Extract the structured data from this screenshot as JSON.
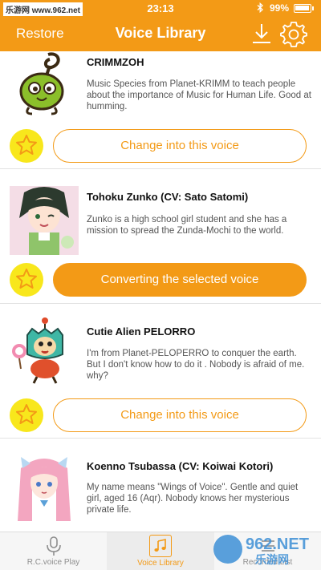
{
  "status_bar": {
    "watermark": "乐游网 www.962.net",
    "time": "23:13",
    "bluetooth_icon": "bluetooth-icon",
    "battery": "99%"
  },
  "nav": {
    "restore_label": "Restore",
    "title": "Voice Library",
    "download_icon": "download-icon",
    "settings_icon": "gear-icon"
  },
  "voices": [
    {
      "name": "CRIMMZOH",
      "description": "Music Species from Planet-KRIMM to teach people about the importance of Music for Human Life. Good at humming.",
      "button_label": "Change into this voice",
      "selected": false
    },
    {
      "name": "Tohoku Zunko (CV: Sato Satomi)",
      "description": "Zunko is a high school girl student and she has a mission to spread the Zunda-Mochi to the world.",
      "button_label": "Converting the selected voice",
      "selected": true
    },
    {
      "name": "Cutie Alien PELORRO",
      "description": "I'm from Planet-PELOPERRO to conquer the earth. But I don't know how to do it . Nobody is afraid of me. why?",
      "button_label": "Change into this voice",
      "selected": false
    },
    {
      "name": "Koenno Tsubassa (CV: Koiwai Kotori)",
      "description": "My name means \"Wings of Voice\". Gentle and quiet girl, aged 16 (Aqr). Nobody knows her mysterious private life.",
      "button_label": "",
      "selected": false
    }
  ],
  "tabs": [
    {
      "label": "R.C.voice Play",
      "icon": "microphone-icon",
      "selected": false
    },
    {
      "label": "Voice Library",
      "icon": "music-note-icon",
      "selected": true
    },
    {
      "label": "Recorded List",
      "icon": "list-icon",
      "selected": false
    }
  ],
  "watermark_bottom": "962.NET 乐游网",
  "colors": {
    "accent": "#f39a16",
    "star_bg": "#f8e71c",
    "text_dark": "#111111",
    "text_muted": "#555555"
  }
}
